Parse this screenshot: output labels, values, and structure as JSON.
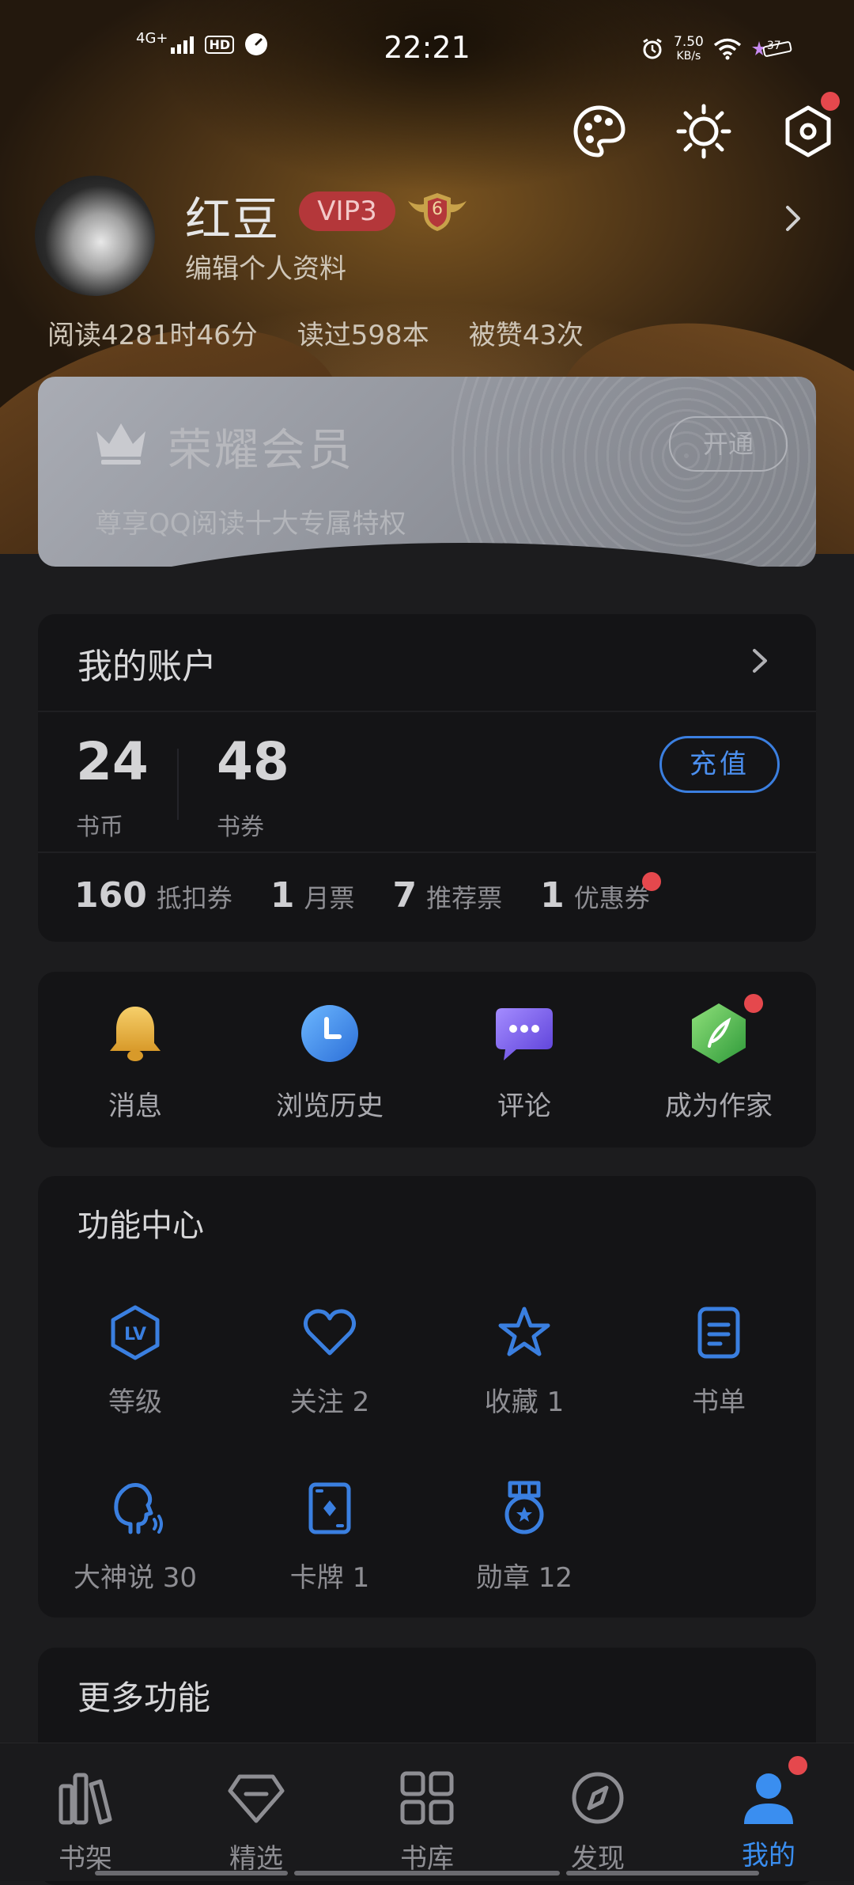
{
  "status_bar": {
    "network": "4G+",
    "hd": "HD",
    "time": "22:21",
    "net_speed_value": "7.50",
    "net_speed_unit": "KB/s",
    "battery": "37"
  },
  "profile": {
    "name": "红豆",
    "vip_badge": "VIP3",
    "level": "6",
    "edit_label": "编辑个人资料",
    "stats": [
      "阅读4281时46分",
      "读过598本",
      "被赞43次"
    ]
  },
  "vip_card": {
    "title": "荣耀会员",
    "subtitle": "尊享QQ阅读十大专属特权",
    "open_label": "开通"
  },
  "account": {
    "title": "我的账户",
    "coins": "24",
    "coins_label": "书币",
    "vouchers": "48",
    "vouchers_label": "书券",
    "recharge_label": "充值",
    "tickets": [
      {
        "count": "160",
        "label": "抵扣券"
      },
      {
        "count": "1",
        "label": "月票"
      },
      {
        "count": "7",
        "label": "推荐票"
      },
      {
        "count": "1",
        "label": "优惠券"
      }
    ]
  },
  "quick_actions": [
    {
      "label": "消息",
      "icon": "bell-icon"
    },
    {
      "label": "浏览历史",
      "icon": "clock-icon"
    },
    {
      "label": "评论",
      "icon": "chat-icon"
    },
    {
      "label": "成为作家",
      "icon": "quill-icon"
    }
  ],
  "function_center": {
    "title": "功能中心",
    "items": [
      {
        "label": "等级",
        "icon": "level-icon"
      },
      {
        "label": "关注 2",
        "icon": "heart-icon"
      },
      {
        "label": "收藏 1",
        "icon": "star-icon"
      },
      {
        "label": "书单",
        "icon": "booklist-icon"
      },
      {
        "label": "大神说 30",
        "icon": "speaker-icon"
      },
      {
        "label": "卡牌 1",
        "icon": "card-icon"
      },
      {
        "label": "勋章 12",
        "icon": "medal-icon"
      }
    ]
  },
  "more": {
    "title": "更多功能"
  },
  "tabbar": [
    {
      "label": "书架",
      "icon": "bookshelf-icon"
    },
    {
      "label": "精选",
      "icon": "diamond-icon"
    },
    {
      "label": "书库",
      "icon": "grid-icon"
    },
    {
      "label": "发现",
      "icon": "compass-icon"
    },
    {
      "label": "我的",
      "icon": "person-icon"
    }
  ],
  "colors": {
    "accent": "#3a8ef0",
    "badge_red": "#e5484d",
    "vip_red": "#b4373a"
  }
}
